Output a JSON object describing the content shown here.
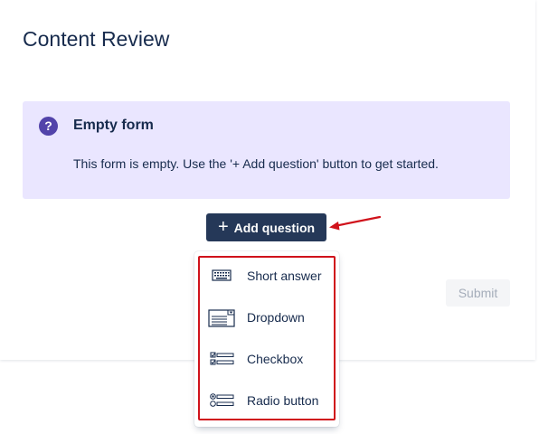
{
  "page": {
    "title": "Content Review"
  },
  "banner": {
    "icon": "question-circle-icon",
    "icon_glyph": "?",
    "title": "Empty form",
    "body": "This form is empty. Use the '+ Add question' button to get started.",
    "background": "#eae6ff",
    "icon_color": "#5243aa"
  },
  "add_button": {
    "icon": "plus-icon",
    "plus": "+",
    "label": "Add question",
    "background": "#253858"
  },
  "submit_button": {
    "label": "Submit"
  },
  "dropdown_menu": {
    "highlight_color": "#d0121b",
    "items": [
      {
        "label": "Short answer",
        "icon": "keyboard-icon"
      },
      {
        "label": "Dropdown",
        "icon": "dropdown-select-icon"
      },
      {
        "label": "Checkbox",
        "icon": "checkbox-list-icon"
      },
      {
        "label": "Radio button",
        "icon": "radio-list-icon"
      }
    ]
  },
  "annotation": {
    "arrow_color": "#d0121b"
  }
}
